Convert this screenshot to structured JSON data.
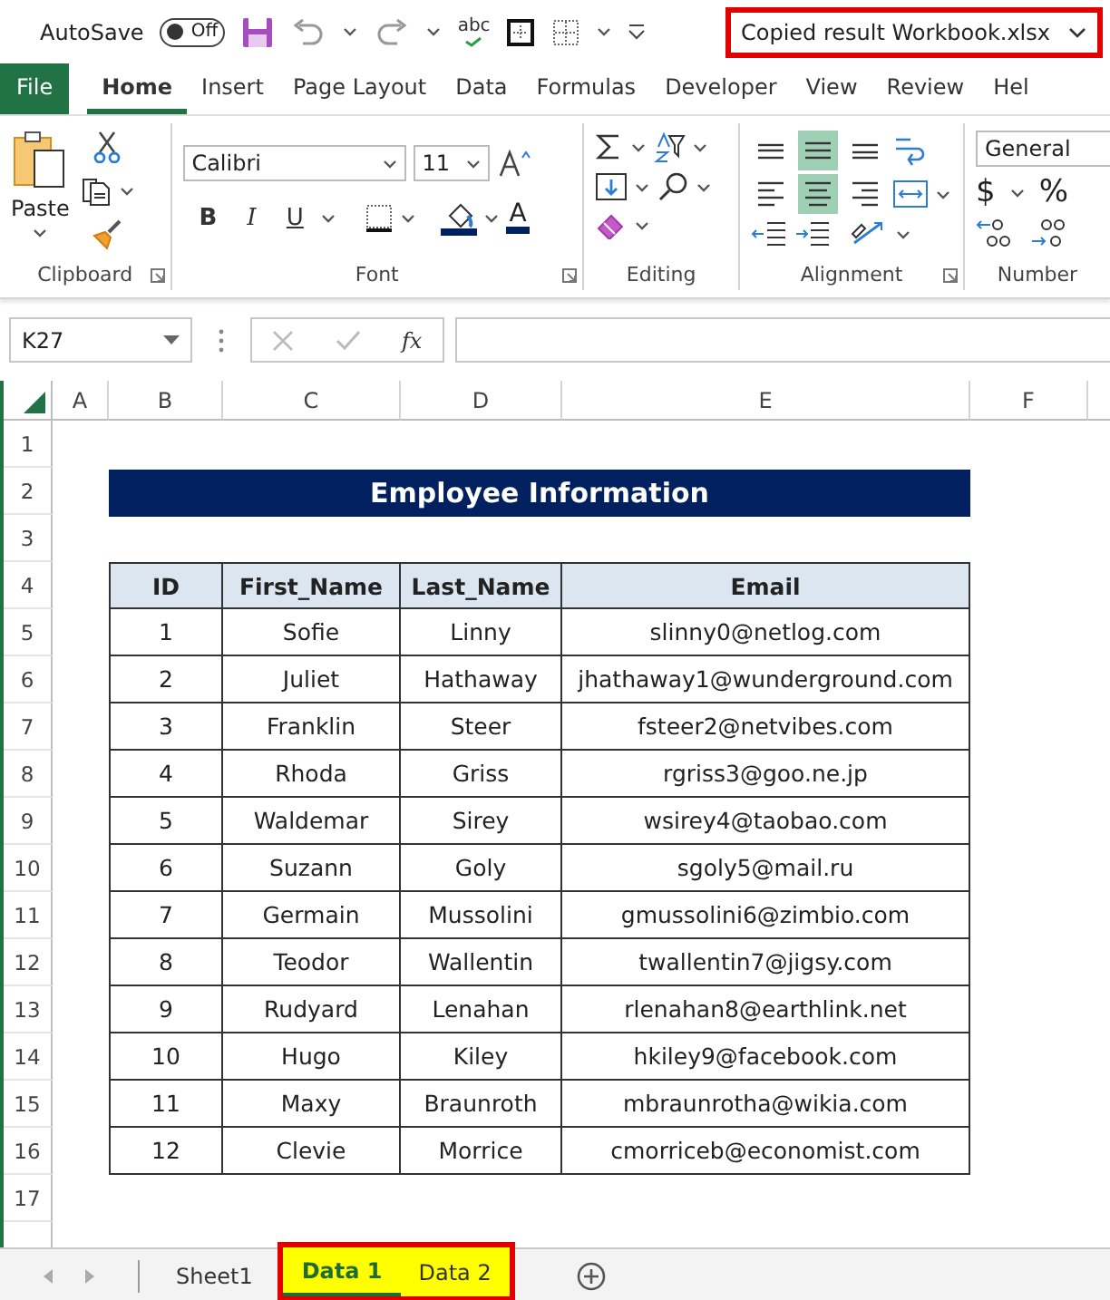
{
  "title_bar": {
    "autosave": {
      "label": "AutoSave",
      "on": false,
      "state_text": "Off"
    },
    "spelling": "abc",
    "filename": "Copied result Workbook.xlsx"
  },
  "menu_tabs": [
    {
      "label": "File",
      "kind": "file",
      "selected": false
    },
    {
      "label": "Home",
      "kind": "tab",
      "selected": true
    },
    {
      "label": "Insert",
      "kind": "tab",
      "selected": false
    },
    {
      "label": "Page Layout",
      "kind": "tab",
      "selected": false
    },
    {
      "label": "Data",
      "kind": "tab",
      "selected": false
    },
    {
      "label": "Formulas",
      "kind": "tab",
      "selected": false
    },
    {
      "label": "Developer",
      "kind": "tab",
      "selected": false
    },
    {
      "label": "View",
      "kind": "tab",
      "selected": false
    },
    {
      "label": "Review",
      "kind": "tab",
      "selected": false
    },
    {
      "label": "Hel",
      "kind": "tab",
      "selected": false
    }
  ],
  "ribbon": {
    "clipboard": {
      "paste": "Paste",
      "label": "Clipboard"
    },
    "font": {
      "name": "Calibri",
      "size": "11",
      "style_buttons": [
        "B",
        "I",
        "U"
      ],
      "color_letter": "A",
      "label": "Font"
    },
    "editing": {
      "label": "Editing"
    },
    "alignment": {
      "label": "Alignment",
      "buttons": [
        {
          "kind": "top",
          "selected": false
        },
        {
          "kind": "middle",
          "selected": true
        },
        {
          "kind": "bottom",
          "selected": false
        },
        {
          "kind": "left",
          "selected": false
        },
        {
          "kind": "center",
          "selected": true
        },
        {
          "kind": "right",
          "selected": false
        }
      ]
    },
    "number": {
      "format": "General",
      "symbols": [
        "$",
        "%"
      ],
      "label": "Number"
    }
  },
  "formula_bar": {
    "name_box": "K27",
    "function_label": "fx"
  },
  "sheet": {
    "column_headers": [
      "A",
      "B",
      "C",
      "D",
      "E",
      "F"
    ],
    "row_numbers": [
      "1",
      "2",
      "3",
      "4",
      "5",
      "6",
      "7",
      "8",
      "9",
      "10",
      "11",
      "12",
      "13",
      "14",
      "15",
      "16",
      "17"
    ],
    "title": "Employee Information",
    "table": {
      "columns": [
        "ID",
        "First_Name",
        "Last_Name",
        "Email"
      ],
      "rows": [
        [
          "1",
          "Sofie",
          "Linny",
          "slinny0@netlog.com"
        ],
        [
          "2",
          "Juliet",
          "Hathaway",
          "jhathaway1@wunderground.com"
        ],
        [
          "3",
          "Franklin",
          "Steer",
          "fsteer2@netvibes.com"
        ],
        [
          "4",
          "Rhoda",
          "Griss",
          "rgriss3@goo.ne.jp"
        ],
        [
          "5",
          "Waldemar",
          "Sirey",
          "wsirey4@taobao.com"
        ],
        [
          "6",
          "Suzann",
          "Goly",
          "sgoly5@mail.ru"
        ],
        [
          "7",
          "Germain",
          "Mussolini",
          "gmussolini6@zimbio.com"
        ],
        [
          "8",
          "Teodor",
          "Wallentin",
          "twallentin7@jigsy.com"
        ],
        [
          "9",
          "Rudyard",
          "Lenahan",
          "rlenahan8@earthlink.net"
        ],
        [
          "10",
          "Hugo",
          "Kiley",
          "hkiley9@facebook.com"
        ],
        [
          "11",
          "Maxy",
          "Braunroth",
          "mbraunrotha@wikia.com"
        ],
        [
          "12",
          "Clevie",
          "Morrice",
          "cmorriceb@economist.com"
        ]
      ]
    }
  },
  "sheet_tabs": [
    {
      "label": "Sheet1",
      "selected": false
    },
    {
      "label": "Data 1",
      "selected": true,
      "color": "#ffff00"
    },
    {
      "label": "Data 2",
      "selected": false,
      "color": "#ffff00"
    }
  ]
}
